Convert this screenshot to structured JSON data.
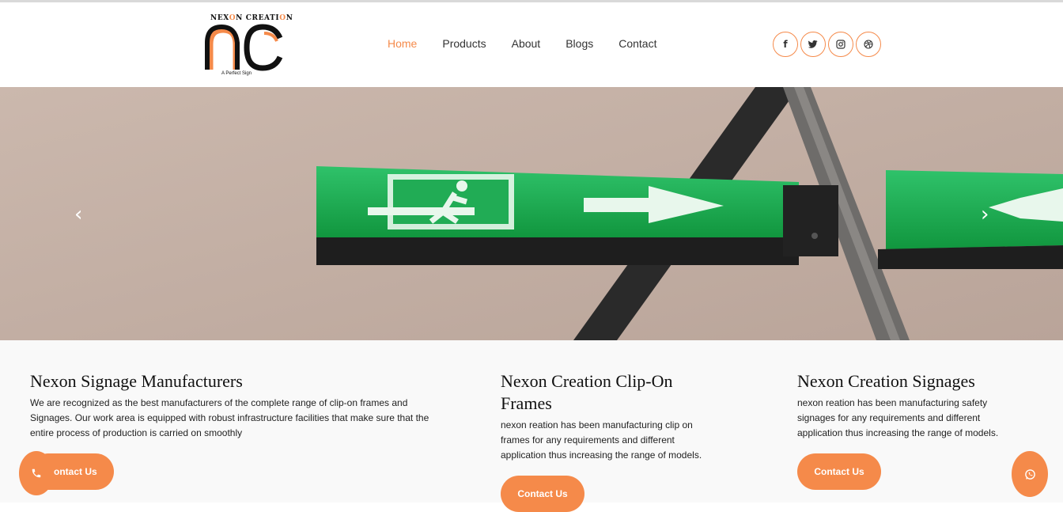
{
  "brand": {
    "name_parts": [
      "NEX",
      "O",
      "N CREATI",
      "O",
      "N"
    ],
    "tagline": "A Perfect Sign",
    "accent": "#f58a4a"
  },
  "nav": {
    "items": [
      {
        "label": "Home",
        "active": true
      },
      {
        "label": "Products",
        "active": false
      },
      {
        "label": "About",
        "active": false
      },
      {
        "label": "Blogs",
        "active": false
      },
      {
        "label": "Contact",
        "active": false
      }
    ]
  },
  "socials": [
    {
      "icon": "facebook-icon",
      "glyph": "f"
    },
    {
      "icon": "twitter-icon",
      "glyph": "🐦"
    },
    {
      "icon": "instagram-icon",
      "glyph": "◎"
    },
    {
      "icon": "dribbble-icon",
      "glyph": "⊛"
    }
  ],
  "hero": {
    "prev_glyph": "‹",
    "next_glyph": "›"
  },
  "sections": [
    {
      "title": "Nexon Signage Manufacturers",
      "text": "We are recognized as the best manufacturers of the complete range of clip-on frames and Signages. Our work area is equipped with robust infrastructure facilities that make sure that the entire process of production is carried on smoothly",
      "button": "Contact Us"
    },
    {
      "title": "Nexon Creation Clip-On Frames",
      "text": "nexon reation has been manufacturing clip on frames for any requirements and different application thus increasing the range of models.",
      "button": "Contact Us"
    },
    {
      "title": "Nexon Creation Signages",
      "text": "nexon reation has been manufacturing safety signages for any requirements and different application thus increasing the range of models.",
      "button": "Contact Us"
    }
  ],
  "floating": {
    "call_icon": "phone-icon",
    "whatsapp_icon": "whatsapp-icon"
  }
}
